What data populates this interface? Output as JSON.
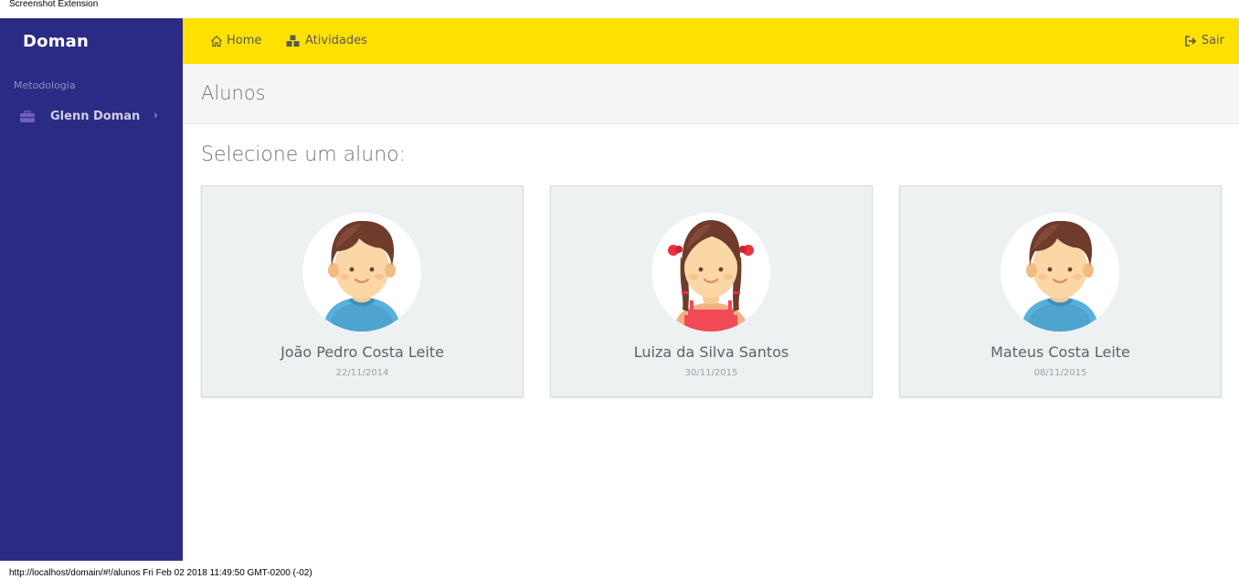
{
  "extension": {
    "title": "Screenshot Extension",
    "footer": "http://localhost/domain/#!/alunos Fri Feb 02 2018 11:49:50 GMT-0200 (-02)"
  },
  "sidebar": {
    "brand": "Doman",
    "section": "Metodologia",
    "items": [
      {
        "label": "Glenn Doman",
        "icon": "briefcase-icon"
      }
    ]
  },
  "topbar": {
    "home": "Home",
    "atividades": "Atividades",
    "sair": "Sair",
    "color": "#ffe100"
  },
  "page": {
    "title": "Alunos",
    "prompt": "Selecione um aluno:"
  },
  "students": [
    {
      "name": "João Pedro Costa Leite",
      "date": "22/11/2014",
      "avatar": "boy-avatar-icon"
    },
    {
      "name": "Luiza da Silva Santos",
      "date": "30/11/2015",
      "avatar": "girl-avatar-icon"
    },
    {
      "name": "Mateus Costa Leite",
      "date": "08/11/2015",
      "avatar": "boy-avatar-icon"
    }
  ],
  "colors": {
    "sidebar": "#2b2a84",
    "card": "#edf1f2"
  }
}
